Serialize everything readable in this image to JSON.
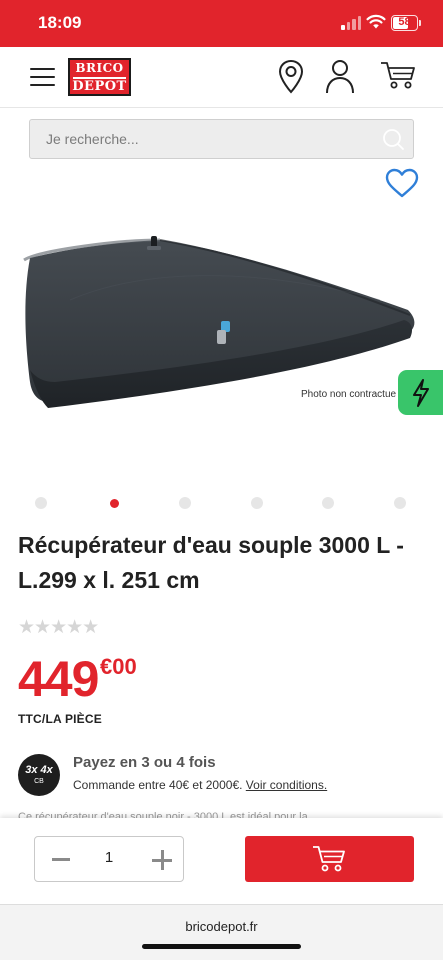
{
  "status_bar": {
    "time": "18:09",
    "battery": "58"
  },
  "header": {
    "logo_line1": "BRICO",
    "logo_line2": "DEPOT",
    "icons": [
      "menu-icon",
      "location-pin-icon",
      "user-icon",
      "cart-icon"
    ]
  },
  "search": {
    "placeholder": "Je recherche..."
  },
  "product": {
    "image_caption": "Photo non contractue",
    "carousel": {
      "count": 6,
      "active_index": 1
    },
    "title": "Récupérateur d'eau souple 3000 L - L.299 x l. 251 cm",
    "rating": {
      "stars_display": "★★★★★",
      "value": 0,
      "max": 5
    },
    "price_int": "449",
    "price_cents": "€00",
    "unit": "TTC/LA PIÈCE",
    "description_teaser": "Ce récupérateur d'eau souple noir - 3000 L est idéal pour la"
  },
  "payment": {
    "badge_main": "3x 4x",
    "badge_sub": "CB",
    "title": "Payez en 3 ou 4 fois",
    "subtitle": "Commande entre 40€ et 2000€.",
    "link": "Voir conditions."
  },
  "action_bar": {
    "quantity": "1"
  },
  "browser": {
    "url": "bricodepot.fr"
  },
  "colors": {
    "brand_red": "#e1242c",
    "flash_green": "#39c56a",
    "favorite_blue": "#2f7fd8"
  }
}
